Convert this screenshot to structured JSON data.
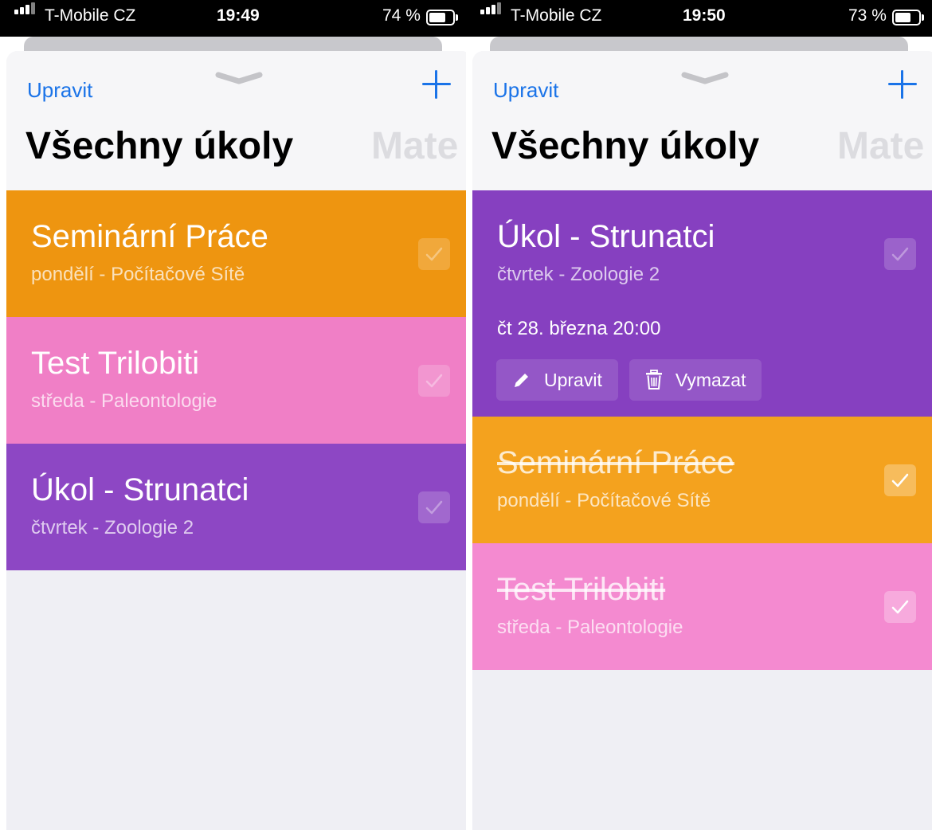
{
  "colors": {
    "accent": "#1a73e8",
    "orange": "#ee9510",
    "orange_done": "#f4a21e",
    "pink": "#f07fc6",
    "pink_done": "#f48ad0",
    "purple": "#8d47c4",
    "purple_expanded": "#8640c0"
  },
  "screens": [
    {
      "status": {
        "carrier": "T-Mobile CZ",
        "time": "19:49",
        "battery": "74 %",
        "battery_level": 0.74
      },
      "nav": {
        "edit": "Upravit",
        "add_icon": "plus-icon"
      },
      "title": "Všechny úkoly",
      "next_tab": "Mate",
      "tasks": [
        {
          "name": "Seminární Práce",
          "subtitle": "pondělí - Počítačové Sítě",
          "done": false,
          "color": "#ee9510"
        },
        {
          "name": "Test Trilobiti",
          "subtitle": "středa - Paleontologie",
          "done": false,
          "color": "#f07fc6"
        },
        {
          "name": "Úkol - Strunatci",
          "subtitle": "čtvrtek - Zoologie 2",
          "done": false,
          "color": "#8d47c4"
        }
      ]
    },
    {
      "status": {
        "carrier": "T-Mobile CZ",
        "time": "19:50",
        "battery": "73 %",
        "battery_level": 0.73
      },
      "nav": {
        "edit": "Upravit",
        "add_icon": "plus-icon"
      },
      "title": "Všechny úkoly",
      "next_tab": "Mate",
      "tasks": [
        {
          "name": "Úkol - Strunatci",
          "subtitle": "čtvrtek - Zoologie 2",
          "done": false,
          "expanded": true,
          "color": "#8640c0",
          "due": "čt 28. března  20:00",
          "actions": {
            "edit": "Upravit",
            "edit_icon": "pencil-icon",
            "delete": "Vymazat",
            "delete_icon": "trash-icon"
          }
        },
        {
          "name": "Seminární Práce",
          "subtitle": "pondělí - Počítačové Sítě",
          "done": true,
          "color": "#f4a21e"
        },
        {
          "name": "Test Trilobiti",
          "subtitle": "středa - Paleontologie",
          "done": true,
          "color": "#f48ad0"
        }
      ]
    }
  ]
}
